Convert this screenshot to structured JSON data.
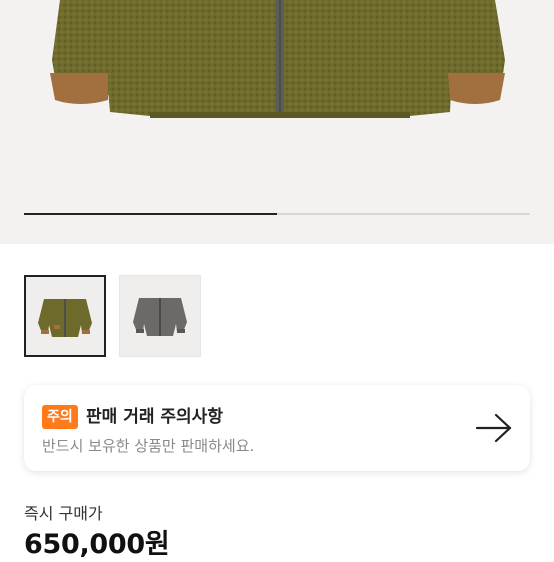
{
  "product": {
    "image_carousel": {
      "current_index": 1,
      "total": 2,
      "progress_fraction": 0.5
    },
    "thumbnails": [
      {
        "name": "olive-fleece-jacket",
        "selected": true
      },
      {
        "name": "gray-fleece-jacket",
        "selected": false
      }
    ]
  },
  "notice": {
    "badge": "주의",
    "title": "판매 거래 주의사항",
    "subtitle": "반드시 보유한 상품만 판매하세요.",
    "arrow_icon": "arrow-right-icon"
  },
  "pricing": {
    "label": "즉시 구매가",
    "value": "650,000원"
  },
  "colors": {
    "badge": "#ff7a1a",
    "hero_bg": "#f3f2f0",
    "jacket_olive": "#6e6a2c",
    "jacket_gray": "#6d6966",
    "cuff_brown": "#a2703e"
  }
}
